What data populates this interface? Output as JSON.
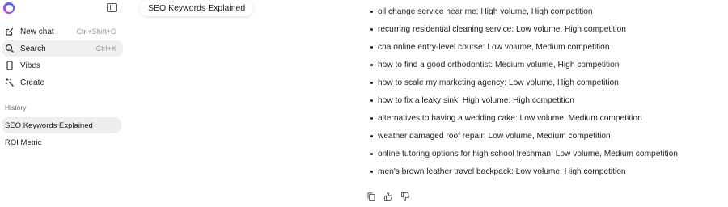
{
  "sidebar": {
    "nav": [
      {
        "label": "New chat",
        "shortcut": "Ctrl+Shift+O",
        "icon": "compose-icon"
      },
      {
        "label": "Search",
        "shortcut": "Ctrl+K",
        "icon": "search-icon"
      },
      {
        "label": "Vibes",
        "shortcut": "",
        "icon": "phone-icon"
      },
      {
        "label": "Create",
        "shortcut": "",
        "icon": "sparkle-wand-icon"
      }
    ],
    "history_label": "History",
    "history": [
      {
        "label": "SEO Keywords Explained",
        "active": true
      },
      {
        "label": "ROI Metric",
        "active": false
      }
    ]
  },
  "chat": {
    "title": "SEO Keywords Explained",
    "keywords": [
      "oil change service near me: High volume, High competition",
      "recurring residential cleaning service: Low volume, High competition",
      "cna online entry-level course: Low volume, Medium competition",
      "how to find a good orthodontist: Medium volume, High competition",
      "how to scale my marketing agency: Low volume, High competition",
      "how to fix a leaky sink: High volume, High competition",
      "alternatives to having a wedding cake: Low volume, Medium competition",
      "weather damaged roof repair: Low volume, Medium competition",
      "online tutoring options for high school freshman: Low volume, Medium competition",
      "men's brown leather travel backpack: Low volume, High competition"
    ],
    "actions": [
      "copy-icon",
      "thumbs-up-icon",
      "thumbs-down-icon"
    ]
  },
  "colors": {
    "accent": "#3b6cf6",
    "active_bg": "#f0f0f0",
    "text": "#1f1f1f",
    "muted": "#9a9a9a"
  }
}
